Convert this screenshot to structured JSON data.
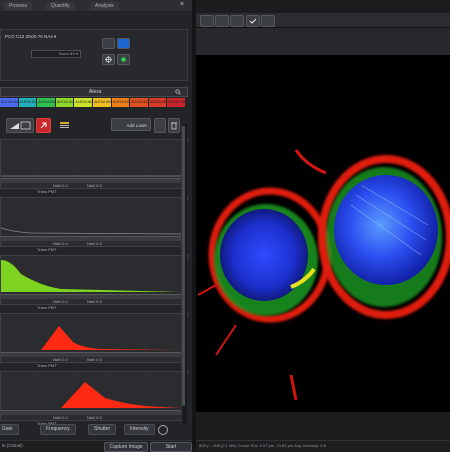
{
  "top_tabs": [
    "Process",
    "Quantify",
    "Analysis"
  ],
  "channel_panel": {
    "line1": "PCO C12   20x/0.75 NA4   ▾",
    "line2": "Zoom 8X   ▾"
  },
  "alexa_bar": {
    "label": "Alexa"
  },
  "filters": [
    {
      "label": "ALEXA 405",
      "color": "#4a6cf0"
    },
    {
      "label": "ALEXA 514",
      "color": "#1fb0b8"
    },
    {
      "label": "ALEXA 532",
      "color": "#2fc050"
    },
    {
      "label": "ALEXA 546",
      "color": "#8fd82a"
    },
    {
      "label": "ALEXA 568",
      "color": "#cce22a"
    },
    {
      "label": "ALEXA 594",
      "color": "#f0c020"
    },
    {
      "label": "ALEXA 633",
      "color": "#f08018"
    },
    {
      "label": "ALEXA 647",
      "color": "#e05020"
    },
    {
      "label": "ALEXA 680",
      "color": "#d83a28"
    },
    {
      "label": "ALEXA 750",
      "color": "#c8242a"
    }
  ],
  "toolbar": {
    "add_laser_label": "Add Laser"
  },
  "histograms": [
    {
      "label": "Trans PMT",
      "color": "#8a8d92",
      "shape": "flat",
      "sub_a": "NaN 0.0",
      "sub_b": "NaN 0.5"
    },
    {
      "label": "Trans PMT",
      "color": "#8a8d92",
      "shape": "decay",
      "sub_a": "NaN 0.0",
      "sub_b": "NaN 0.5"
    },
    {
      "label": "Trans PMT",
      "color": "#7ed321",
      "shape": "green",
      "sub_a": "NaN 0.0",
      "sub_b": "NaN 0.5"
    },
    {
      "label": "Trans PMT",
      "color": "#ff2a14",
      "shape": "red1",
      "sub_a": "NaN 0.0",
      "sub_b": "NaN 0.5"
    },
    {
      "label": "Trans PMT",
      "color": "#ff2a14",
      "shape": "red2",
      "sub_a": "NaN 0.0",
      "sub_b": "NaN 0.5"
    }
  ],
  "bottom_tabs": [
    "Gain",
    "Frequency",
    "Shutter",
    "Intensity"
  ],
  "status": {
    "left": "le (Global)",
    "capture_label": "Capture Image",
    "start_label": "Start"
  },
  "viewer_status": "808 y – 808 (2.1 MB)   Cursor   Pos: 0.07 μm, 23.81 μm   Avg. Intensity: 0.8",
  "icons": [
    "select-icon",
    "pan-icon",
    "zoom-icon",
    "check-icon",
    "crop-icon",
    "settings-icon",
    "x-icon",
    "trash-icon"
  ]
}
